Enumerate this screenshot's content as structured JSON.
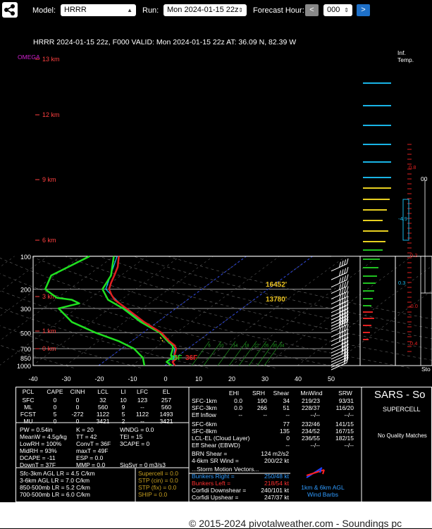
{
  "toolbar": {
    "model_label": "Model:",
    "model_value": "HRRR",
    "run_label": "Run:",
    "run_value": "Mon 2024-01-15 22z",
    "forecast_label": "Forecast Hour:",
    "prev_glyph": "<",
    "forecast_value": "000",
    "next_glyph": ">"
  },
  "sounding": {
    "header": "HRRR 2024-01-15 22z, F000  VALID: Mon 2024-01-15 22z  AT: 36.09 N, 82.39 W",
    "omega_label": "OMEGA",
    "inf_temp_label": "Inf.\nTemp.",
    "pressure_levels": [
      100,
      200,
      300,
      500,
      700,
      850,
      1000
    ],
    "height_labels": [
      "13 km",
      "12 km",
      "9 km",
      "6 km",
      "3 km",
      "1 km",
      "0 km"
    ],
    "temp_ticks": [
      -40,
      -30,
      -20,
      -10,
      0,
      10,
      20,
      30,
      40,
      50
    ],
    "mixing_ratio_labels": [
      "6",
      "10",
      "14",
      "18",
      "22",
      "26",
      "30",
      "34"
    ],
    "annotations": {
      "upper": "16452'",
      "lower": "13780'",
      "sfc_td": "35F",
      "sfc_t": "36F"
    },
    "right_values": [
      "0.8",
      "0.2",
      "-0.0",
      "0.0",
      "0.4",
      "0.3",
      "-4.9"
    ],
    "partial_labels": [
      "00",
      "Sto"
    ],
    "profiles": {
      "temperature": [
        [
          1000,
          3
        ],
        [
          925,
          0.8
        ],
        [
          850,
          0.6
        ],
        [
          800,
          -1.4
        ],
        [
          700,
          -3.5
        ],
        [
          650,
          -5.5
        ],
        [
          600,
          -8.5
        ],
        [
          500,
          -14.5
        ],
        [
          400,
          -24
        ],
        [
          300,
          -35
        ],
        [
          250,
          -42
        ],
        [
          225,
          -45
        ],
        [
          200,
          -48
        ],
        [
          175,
          -50
        ],
        [
          150,
          -52
        ],
        [
          125,
          -54.5
        ],
        [
          100,
          -58.5
        ]
      ],
      "dewpoint": [
        [
          1000,
          2
        ],
        [
          925,
          -1
        ],
        [
          850,
          -1
        ],
        [
          800,
          -2.5
        ],
        [
          700,
          -4.5
        ],
        [
          650,
          -6
        ],
        [
          600,
          -9
        ],
        [
          500,
          -15
        ],
        [
          400,
          -25
        ],
        [
          300,
          -36
        ],
        [
          250,
          -44
        ],
        [
          200,
          -50
        ],
        [
          150,
          -53
        ],
        [
          100,
          -60
        ]
      ],
      "wetbulb": [
        [
          1000,
          2.5
        ],
        [
          850,
          -0.5
        ],
        [
          700,
          -4
        ],
        [
          500,
          -15
        ],
        [
          400,
          -24.5
        ],
        [
          300,
          -35.5
        ],
        [
          200,
          -49
        ],
        [
          100,
          -59
        ]
      ],
      "omega": [
        [
          1000,
          -3.5
        ],
        [
          850,
          -4
        ],
        [
          700,
          -7
        ],
        [
          600,
          -12
        ],
        [
          500,
          -20
        ],
        [
          400,
          -28
        ],
        [
          330,
          -31
        ],
        [
          300,
          -32.5
        ],
        [
          270,
          -25.5
        ],
        [
          250,
          -28
        ],
        [
          240,
          -33
        ],
        [
          220,
          -35
        ],
        [
          200,
          -37
        ],
        [
          150,
          -35
        ],
        [
          100,
          -22
        ]
      ]
    }
  },
  "params_table": {
    "headers": [
      "PCL",
      "CAPE",
      "CINH",
      "LCL",
      "LI",
      "LFC",
      "EL"
    ],
    "rows": [
      [
        "SFC",
        "0",
        "0",
        "32",
        "10",
        "123",
        "257"
      ],
      [
        "ML",
        "0",
        "0",
        "560",
        "9",
        "--",
        "560"
      ],
      [
        "FCST",
        "5",
        "-272",
        "1122",
        "5",
        "1122",
        "1493"
      ],
      [
        "MU",
        "0",
        "0",
        "3421",
        "2",
        "--",
        "3421"
      ]
    ]
  },
  "thermo": [
    [
      "PW = 0.54in",
      "K = 20",
      "WNDG = 0.0"
    ],
    [
      "MeanW = 4.5g/kg",
      "TT = 42",
      "TEI = 15"
    ],
    [
      "LowRH = 100%",
      "ConvT = 36F",
      "3CAPE = 0"
    ],
    [
      "MidRH = 93%",
      "maxT = 49F",
      ""
    ],
    [
      "DCAPE = -11",
      "ESP = 0.0",
      ""
    ],
    [
      "DownT = 37F",
      "MMP = 0.0",
      "SigSvr = 0 m3/s3"
    ]
  ],
  "lapse_rates": [
    "Sfc-3km AGL LR = 4.5 C/km",
    "3-6km AGL LR = 7.0 C/km",
    "850-500mb LR = 5.2 C/km",
    "700-500mb LR = 6.0 C/km"
  ],
  "composite": [
    "Supercell = 0.0",
    "STP (cin) = 0.0",
    "STP (fix) = 0.0",
    "SHIP = 0.0"
  ],
  "kinematics": {
    "headers": [
      "EHI",
      "SRH",
      "Shear",
      "MnWind",
      "SRW"
    ],
    "rows": [
      [
        "SFC-1km",
        "0.0",
        "190",
        "34",
        "219/23",
        "93/31"
      ],
      [
        "SFC-3km",
        "0.0",
        "266",
        "51",
        "228/37",
        "116/20"
      ],
      [
        "Eff Inflow",
        "--",
        "--",
        "--",
        "--/--",
        "--/--"
      ],
      [
        "SFC-6km",
        "",
        "",
        "77",
        "232/46",
        "141/15"
      ],
      [
        "SFC-8km",
        "",
        "",
        "135",
        "234/52",
        "167/15"
      ],
      [
        "LCL-EL (Cloud Layer)",
        "",
        "",
        "0",
        "236/55",
        "182/15"
      ],
      [
        "Eff Shear (EBWD)",
        "",
        "",
        "--",
        "--/--",
        "--/--"
      ]
    ],
    "brn_shear_label": "BRN Shear =",
    "brn_shear_value": "124 m2/s2",
    "sr_wind_label": "4-6km SR Wind =",
    "sr_wind_value": "200/22 kt",
    "vectors_title": "...Storm Motion Vectors...",
    "vectors": [
      [
        "Bunkers Right =",
        "250/48 kt"
      ],
      [
        "Bunkers Left =",
        "218/54 kt"
      ],
      [
        "Corfidi Downshear =",
        "240/101 kt"
      ],
      [
        "Corfidi Upshear =",
        "247/37 kt"
      ]
    ],
    "barbs_caption": "1km & 6km AGL\nWind Barbs"
  },
  "sars": {
    "title": "SARS - So",
    "subtitle": "SUPERCELL",
    "no_matches": "No Quality Matches"
  },
  "footer": "© 2015-2024 pivotalweather.com - Soundings pc",
  "colors": {
    "temperature": "#e02020",
    "dewpoint": "#20e020",
    "wetbulb": "#00c8ff",
    "omega": "#ff00ff",
    "accent_button": "#1e70c8",
    "height_label": "#ff4040"
  }
}
